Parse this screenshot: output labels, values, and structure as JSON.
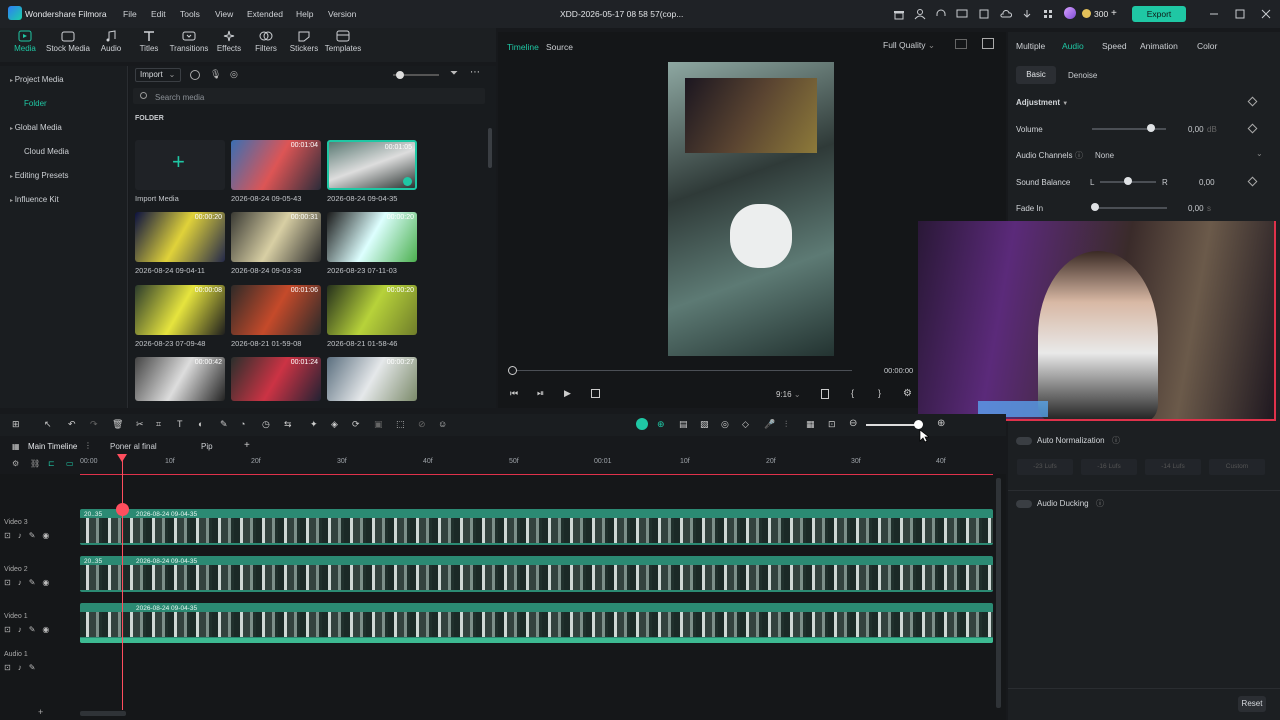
{
  "app": {
    "name": "Wondershare Filmora",
    "title": "XDD-2026-05-17 08 58 57(cop...",
    "coins": "300",
    "export_label": "Export"
  },
  "menu": [
    "File",
    "Edit",
    "Tools",
    "View",
    "Extended",
    "Help",
    "Version"
  ],
  "tools": [
    "Media",
    "Stock Media",
    "Audio",
    "Titles",
    "Transitions",
    "Effects",
    "Filters",
    "Stickers",
    "Templates"
  ],
  "sidenav": [
    "Project Media",
    "Folder",
    "Global Media",
    "Cloud Media",
    "Editing Presets",
    "Influence Kit"
  ],
  "media": {
    "import_label": "Import",
    "search_placeholder": "Search media",
    "folder_header": "FOLDER",
    "import_media_label": "Import Media",
    "items": [
      {
        "label": "2026-08-24 09-05-43",
        "dur": "00:01:04"
      },
      {
        "label": "2026-08-24 09-04-35",
        "dur": "00:01:05"
      },
      {
        "label": "2026-08-24 09-04-11",
        "dur": "00:00:20"
      },
      {
        "label": "2026-08-24 09-03-39",
        "dur": "00:00:31"
      },
      {
        "label": "2026-08-23 07-11-03",
        "dur": "00:00:20"
      },
      {
        "label": "2026-08-23 07-09-48",
        "dur": "00:00:08"
      },
      {
        "label": "2026-08-21 01-59-08",
        "dur": "00:01:06"
      },
      {
        "label": "2026-08-21 01-58-46",
        "dur": "00:00:20"
      },
      {
        "label": "",
        "dur": "00:00:42"
      },
      {
        "label": "",
        "dur": "00:01:24"
      },
      {
        "label": "",
        "dur": "00:00:27"
      }
    ]
  },
  "preview": {
    "tab_timeline": "Timeline",
    "tab_source": "Source",
    "quality": "Full Quality",
    "ratio": "9:16",
    "timecode": "00:00:00"
  },
  "right": {
    "tabs": [
      "Multiple",
      "Audio",
      "Speed",
      "Animation",
      "Color"
    ],
    "subtabs": [
      "Basic",
      "Denoise"
    ],
    "adjustment": "Adjustment",
    "volume_label": "Volume",
    "volume_value": "0,00",
    "volume_unit": "dB",
    "channels_label": "Audio Channels",
    "channels_value": "None",
    "balance_label": "Sound Balance",
    "balance_l": "L",
    "balance_r": "R",
    "balance_value": "0,00",
    "fadein_label": "Fade In",
    "fadein_value": "0,00",
    "fadein_unit": "s",
    "autonorm_label": "Auto Normalization",
    "lufs": [
      "-23 Lufs",
      "-16 Lufs",
      "-14 Lufs",
      "Custom"
    ],
    "ducking_label": "Audio Ducking",
    "reset_label": "Reset"
  },
  "timeline": {
    "tabs": [
      "Main Timeline",
      "Poner al final",
      "Pip"
    ],
    "ticks": [
      "00:00",
      "10f",
      "20f",
      "30f",
      "40f",
      "50f",
      "00:01",
      "10f",
      "20f",
      "30f",
      "40f"
    ],
    "tracks": [
      {
        "name": "Video 3",
        "clip": "2026-08-24 09-04-35",
        "mini": "20..35"
      },
      {
        "name": "Video 2",
        "clip": "2026-08-24 09-04-35",
        "mini": "20..35"
      },
      {
        "name": "Video 1",
        "clip": "2026-08-24 09-04-35",
        "mini": ""
      },
      {
        "name": "Audio 1",
        "clip": "",
        "mini": ""
      }
    ]
  },
  "colors": {
    "accent": "#1fc7a4",
    "playhead": "#ff4e5e",
    "clip": "#2b8a73"
  }
}
